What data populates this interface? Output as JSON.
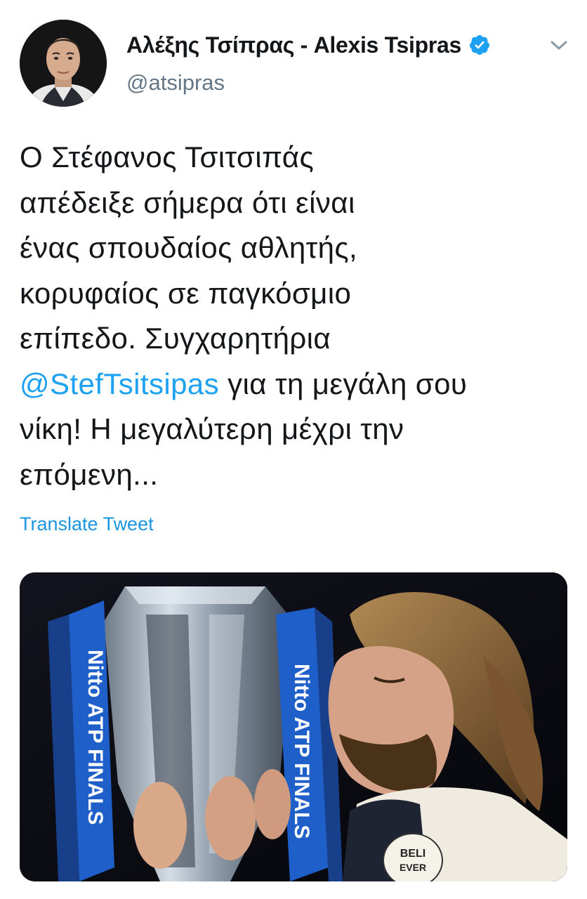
{
  "author": {
    "display_name": "Αλέξης Τσίπρας - Alexis Tsipras",
    "handle": "@atsipras",
    "verified": true,
    "avatar_icon": "profile-photo"
  },
  "tweet": {
    "lines": [
      "Ο Στέφανος Τσιτσιπάς",
      "απέδειξε σήμερα ότι είναι",
      "ένας σπουδαίος αθλητής,",
      "κορυφαίος σε παγκόσμιο",
      "επίπεδο. Συγχαρητήρια"
    ],
    "mention": "@StefTsitsipas",
    "mention_suffix": " για τη μεγάλη σου",
    "lines_after": [
      "νίκη! Η μεγαλύτερη μέχρι την",
      "επόμενη..."
    ],
    "translate_label": "Translate Tweet"
  },
  "media": {
    "description_icon": "photo-trophy-kiss",
    "ribbon_text_left": "Nitto ATP FINALS",
    "ribbon_text_right": "Nitto ATP FINALS",
    "shirt_text": "BELI EVER"
  },
  "icons": {
    "verified": "verified-badge-icon",
    "menu": "chevron-down-icon"
  },
  "colors": {
    "link": "#1da1f2",
    "verified": "#1da1f2",
    "secondary": "#657786"
  }
}
